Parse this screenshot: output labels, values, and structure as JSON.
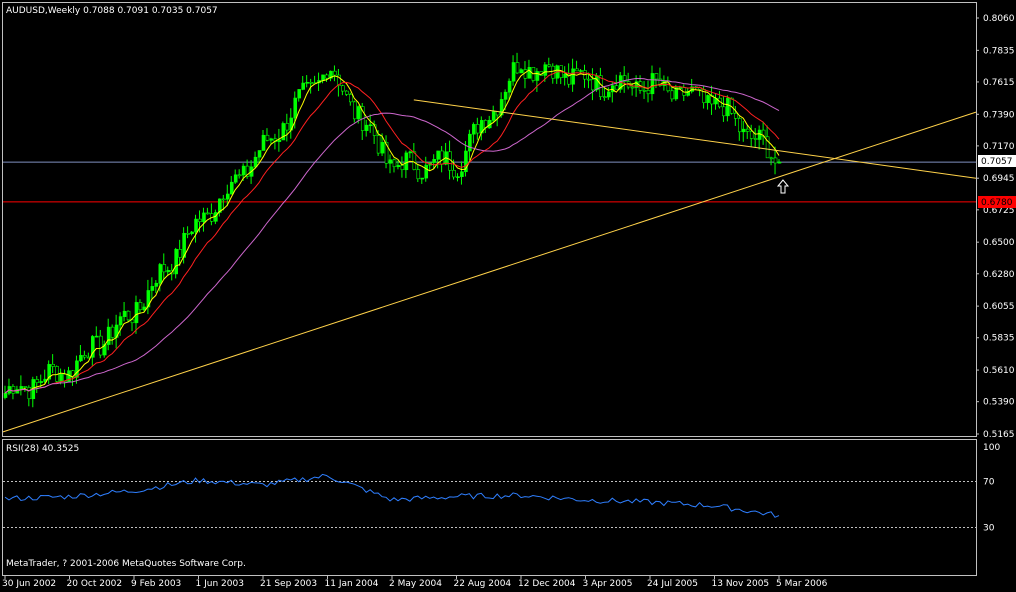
{
  "window": {
    "main_header": "AUDUSD,Weekly  0.7088 0.7091 0.7035 0.7057",
    "indicator_header": "RSI(28) 40.3525",
    "copyright": "MetaTrader, ? 2001-2006 MetaQuotes Software Corp."
  },
  "colors": {
    "background": "#000000",
    "frame": "#c0c0c0",
    "candle_up": "#00ff00",
    "candle_down": "#00ff00",
    "ma_fast": "#ffff00",
    "ma_mid": "#ff2020",
    "ma_slow": "#cc66cc",
    "trendline": "#ffd24a",
    "support_line": "#ff0000",
    "current_price_line": "#8090c0",
    "rsi_line": "#2f7fff",
    "rsi_level": "#c0c0c0",
    "arrow": "#ffffff"
  },
  "chart_data": [
    {
      "type": "candlestick",
      "symbol": "AUDUSD",
      "timeframe": "Weekly",
      "ohlc_last": {
        "open": 0.7088,
        "high": 0.7091,
        "low": 0.7035,
        "close": 0.7057
      },
      "ylim": [
        0.5165,
        0.806
      ],
      "y_ticks": [
        "0.8060",
        "0.7835",
        "0.7615",
        "0.7390",
        "0.7170",
        "0.6945",
        "0.6725",
        "0.6500",
        "0.6280",
        "0.6055",
        "0.5835",
        "0.5610",
        "0.5390",
        "0.5165"
      ],
      "x_ticks": [
        "30 Jun 2002",
        "20 Oct 2002",
        "9 Feb 2003",
        "1 Jun 2003",
        "21 Sep 2003",
        "11 Jan 2004",
        "2 May 2004",
        "22 Aug 2004",
        "12 Dec 2004",
        "3 Apr 2005",
        "24 Jul 2005",
        "13 Nov 2005",
        "5 Mar 2006"
      ],
      "series": [
        {
          "name": "close",
          "x": [
            "30 Jun 2002",
            "20 Oct 2002",
            "9 Feb 2003",
            "1 Jun 2003",
            "21 Sep 2003",
            "11 Jan 2004",
            "2 May 2004",
            "22 Aug 2004",
            "12 Dec 2004",
            "3 Apr 2005",
            "24 Jul 2005",
            "13 Nov 2005",
            "5 Mar 2006"
          ],
          "values": [
            0.545,
            0.562,
            0.602,
            0.664,
            0.715,
            0.772,
            0.703,
            0.705,
            0.775,
            0.763,
            0.758,
            0.747,
            0.7057
          ]
        }
      ],
      "price_labels": {
        "current": "0.7057",
        "support": "0.6780"
      },
      "horizontal_lines": [
        {
          "name": "support",
          "value": 0.678
        },
        {
          "name": "current",
          "value": 0.7057
        }
      ]
    },
    {
      "type": "line",
      "indicator": "RSI(28)",
      "value": 40.3525,
      "ylim": [
        0,
        100
      ],
      "y_ticks": [
        "100",
        "70",
        "30"
      ],
      "levels": [
        70,
        30
      ],
      "series": [
        {
          "name": "RSI(28)",
          "x": [
            "30 Jun 2002",
            "20 Oct 2002",
            "9 Feb 2003",
            "1 Jun 2003",
            "21 Sep 2003",
            "11 Jan 2004",
            "2 May 2004",
            "22 Aug 2004",
            "12 Dec 2004",
            "3 Apr 2005",
            "24 Jul 2005",
            "13 Nov 2005",
            "5 Mar 2006"
          ],
          "values": [
            55,
            57,
            62,
            71,
            67,
            75,
            54,
            57,
            58,
            54,
            52,
            49,
            40.35
          ]
        }
      ]
    }
  ]
}
